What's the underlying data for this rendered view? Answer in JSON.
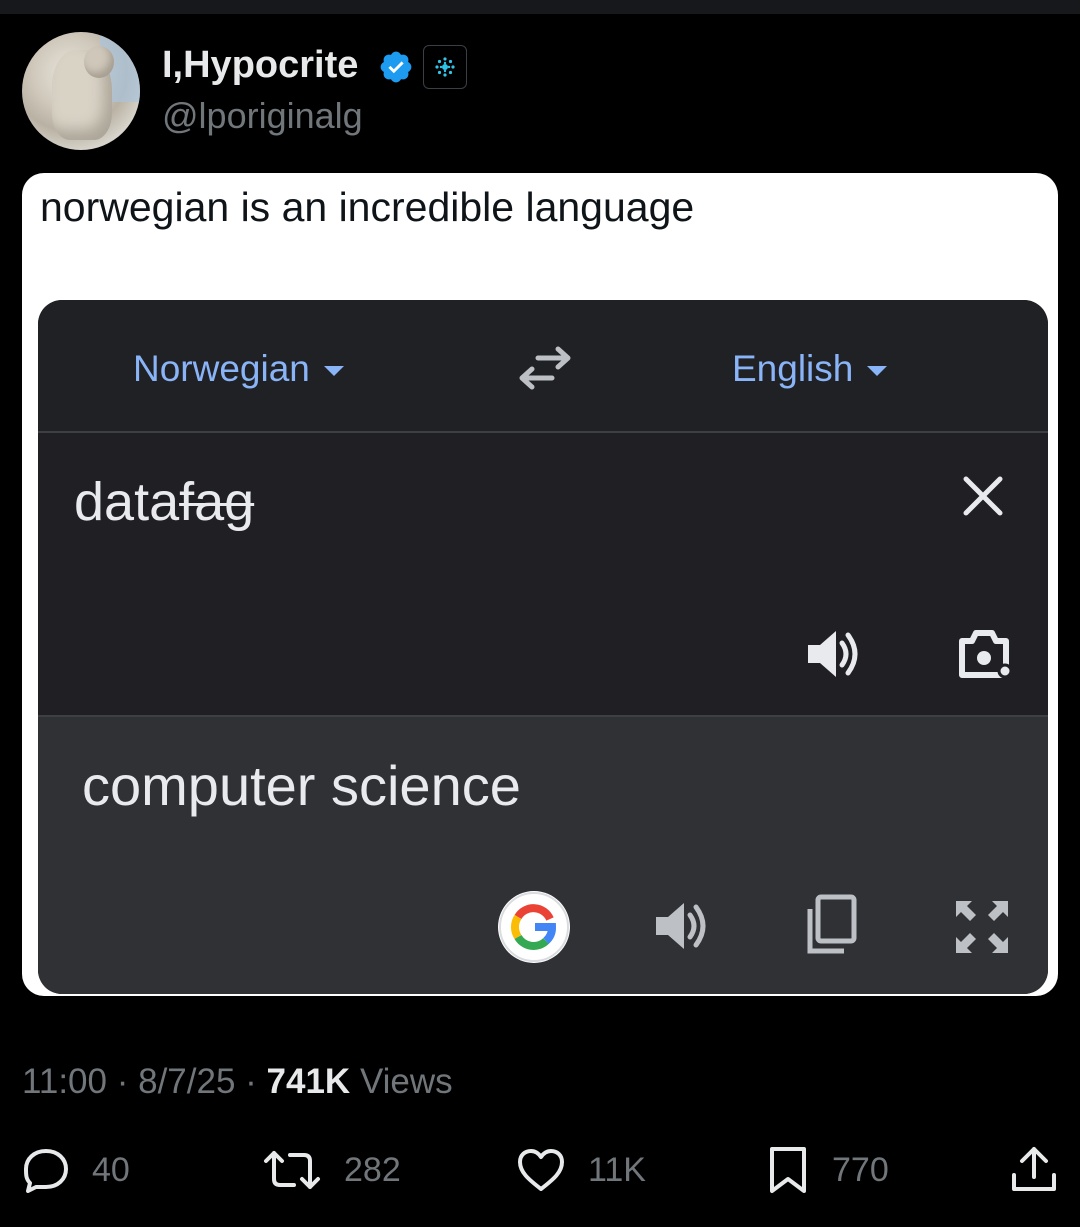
{
  "tweet": {
    "author_name": "I,Hypocrite",
    "author_handle": "@lporiginalg",
    "text": "norwegian is an incredible language",
    "time": "11:00",
    "date": "8/7/25",
    "views_count": "741K",
    "views_label": "Views"
  },
  "translate": {
    "source_lang": "Norwegian",
    "target_lang": "English",
    "input_plain": "data",
    "input_struck": "fag",
    "output": "computer science"
  },
  "actions": {
    "replies": "40",
    "reposts": "282",
    "likes": "11K",
    "bookmarks": "770"
  },
  "colors": {
    "background": "#000000",
    "verified_blue": "#1d9bf0",
    "translate_link": "#8ab4f8",
    "muted_text": "#71767b"
  }
}
